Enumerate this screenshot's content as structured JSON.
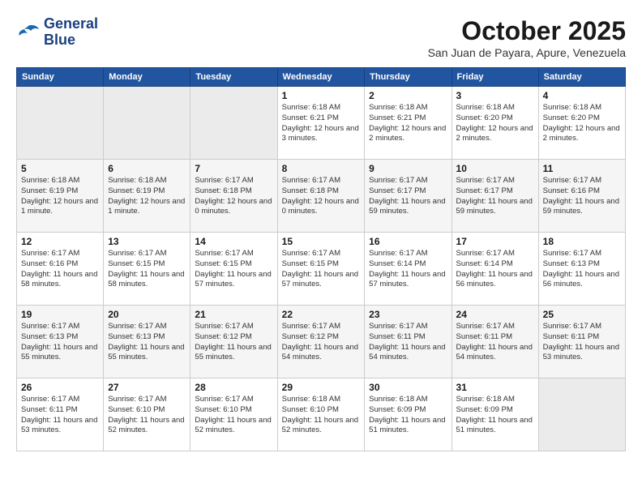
{
  "header": {
    "logo_line1": "General",
    "logo_line2": "Blue",
    "month": "October 2025",
    "location": "San Juan de Payara, Apure, Venezuela"
  },
  "weekdays": [
    "Sunday",
    "Monday",
    "Tuesday",
    "Wednesday",
    "Thursday",
    "Friday",
    "Saturday"
  ],
  "weeks": [
    [
      {
        "day": "",
        "sunrise": "",
        "sunset": "",
        "daylight": ""
      },
      {
        "day": "",
        "sunrise": "",
        "sunset": "",
        "daylight": ""
      },
      {
        "day": "",
        "sunrise": "",
        "sunset": "",
        "daylight": ""
      },
      {
        "day": "1",
        "sunrise": "Sunrise: 6:18 AM",
        "sunset": "Sunset: 6:21 PM",
        "daylight": "Daylight: 12 hours and 3 minutes."
      },
      {
        "day": "2",
        "sunrise": "Sunrise: 6:18 AM",
        "sunset": "Sunset: 6:21 PM",
        "daylight": "Daylight: 12 hours and 2 minutes."
      },
      {
        "day": "3",
        "sunrise": "Sunrise: 6:18 AM",
        "sunset": "Sunset: 6:20 PM",
        "daylight": "Daylight: 12 hours and 2 minutes."
      },
      {
        "day": "4",
        "sunrise": "Sunrise: 6:18 AM",
        "sunset": "Sunset: 6:20 PM",
        "daylight": "Daylight: 12 hours and 2 minutes."
      }
    ],
    [
      {
        "day": "5",
        "sunrise": "Sunrise: 6:18 AM",
        "sunset": "Sunset: 6:19 PM",
        "daylight": "Daylight: 12 hours and 1 minute."
      },
      {
        "day": "6",
        "sunrise": "Sunrise: 6:18 AM",
        "sunset": "Sunset: 6:19 PM",
        "daylight": "Daylight: 12 hours and 1 minute."
      },
      {
        "day": "7",
        "sunrise": "Sunrise: 6:17 AM",
        "sunset": "Sunset: 6:18 PM",
        "daylight": "Daylight: 12 hours and 0 minutes."
      },
      {
        "day": "8",
        "sunrise": "Sunrise: 6:17 AM",
        "sunset": "Sunset: 6:18 PM",
        "daylight": "Daylight: 12 hours and 0 minutes."
      },
      {
        "day": "9",
        "sunrise": "Sunrise: 6:17 AM",
        "sunset": "Sunset: 6:17 PM",
        "daylight": "Daylight: 11 hours and 59 minutes."
      },
      {
        "day": "10",
        "sunrise": "Sunrise: 6:17 AM",
        "sunset": "Sunset: 6:17 PM",
        "daylight": "Daylight: 11 hours and 59 minutes."
      },
      {
        "day": "11",
        "sunrise": "Sunrise: 6:17 AM",
        "sunset": "Sunset: 6:16 PM",
        "daylight": "Daylight: 11 hours and 59 minutes."
      }
    ],
    [
      {
        "day": "12",
        "sunrise": "Sunrise: 6:17 AM",
        "sunset": "Sunset: 6:16 PM",
        "daylight": "Daylight: 11 hours and 58 minutes."
      },
      {
        "day": "13",
        "sunrise": "Sunrise: 6:17 AM",
        "sunset": "Sunset: 6:15 PM",
        "daylight": "Daylight: 11 hours and 58 minutes."
      },
      {
        "day": "14",
        "sunrise": "Sunrise: 6:17 AM",
        "sunset": "Sunset: 6:15 PM",
        "daylight": "Daylight: 11 hours and 57 minutes."
      },
      {
        "day": "15",
        "sunrise": "Sunrise: 6:17 AM",
        "sunset": "Sunset: 6:15 PM",
        "daylight": "Daylight: 11 hours and 57 minutes."
      },
      {
        "day": "16",
        "sunrise": "Sunrise: 6:17 AM",
        "sunset": "Sunset: 6:14 PM",
        "daylight": "Daylight: 11 hours and 57 minutes."
      },
      {
        "day": "17",
        "sunrise": "Sunrise: 6:17 AM",
        "sunset": "Sunset: 6:14 PM",
        "daylight": "Daylight: 11 hours and 56 minutes."
      },
      {
        "day": "18",
        "sunrise": "Sunrise: 6:17 AM",
        "sunset": "Sunset: 6:13 PM",
        "daylight": "Daylight: 11 hours and 56 minutes."
      }
    ],
    [
      {
        "day": "19",
        "sunrise": "Sunrise: 6:17 AM",
        "sunset": "Sunset: 6:13 PM",
        "daylight": "Daylight: 11 hours and 55 minutes."
      },
      {
        "day": "20",
        "sunrise": "Sunrise: 6:17 AM",
        "sunset": "Sunset: 6:13 PM",
        "daylight": "Daylight: 11 hours and 55 minutes."
      },
      {
        "day": "21",
        "sunrise": "Sunrise: 6:17 AM",
        "sunset": "Sunset: 6:12 PM",
        "daylight": "Daylight: 11 hours and 55 minutes."
      },
      {
        "day": "22",
        "sunrise": "Sunrise: 6:17 AM",
        "sunset": "Sunset: 6:12 PM",
        "daylight": "Daylight: 11 hours and 54 minutes."
      },
      {
        "day": "23",
        "sunrise": "Sunrise: 6:17 AM",
        "sunset": "Sunset: 6:11 PM",
        "daylight": "Daylight: 11 hours and 54 minutes."
      },
      {
        "day": "24",
        "sunrise": "Sunrise: 6:17 AM",
        "sunset": "Sunset: 6:11 PM",
        "daylight": "Daylight: 11 hours and 54 minutes."
      },
      {
        "day": "25",
        "sunrise": "Sunrise: 6:17 AM",
        "sunset": "Sunset: 6:11 PM",
        "daylight": "Daylight: 11 hours and 53 minutes."
      }
    ],
    [
      {
        "day": "26",
        "sunrise": "Sunrise: 6:17 AM",
        "sunset": "Sunset: 6:11 PM",
        "daylight": "Daylight: 11 hours and 53 minutes."
      },
      {
        "day": "27",
        "sunrise": "Sunrise: 6:17 AM",
        "sunset": "Sunset: 6:10 PM",
        "daylight": "Daylight: 11 hours and 52 minutes."
      },
      {
        "day": "28",
        "sunrise": "Sunrise: 6:17 AM",
        "sunset": "Sunset: 6:10 PM",
        "daylight": "Daylight: 11 hours and 52 minutes."
      },
      {
        "day": "29",
        "sunrise": "Sunrise: 6:18 AM",
        "sunset": "Sunset: 6:10 PM",
        "daylight": "Daylight: 11 hours and 52 minutes."
      },
      {
        "day": "30",
        "sunrise": "Sunrise: 6:18 AM",
        "sunset": "Sunset: 6:09 PM",
        "daylight": "Daylight: 11 hours and 51 minutes."
      },
      {
        "day": "31",
        "sunrise": "Sunrise: 6:18 AM",
        "sunset": "Sunset: 6:09 PM",
        "daylight": "Daylight: 11 hours and 51 minutes."
      },
      {
        "day": "",
        "sunrise": "",
        "sunset": "",
        "daylight": ""
      }
    ]
  ]
}
